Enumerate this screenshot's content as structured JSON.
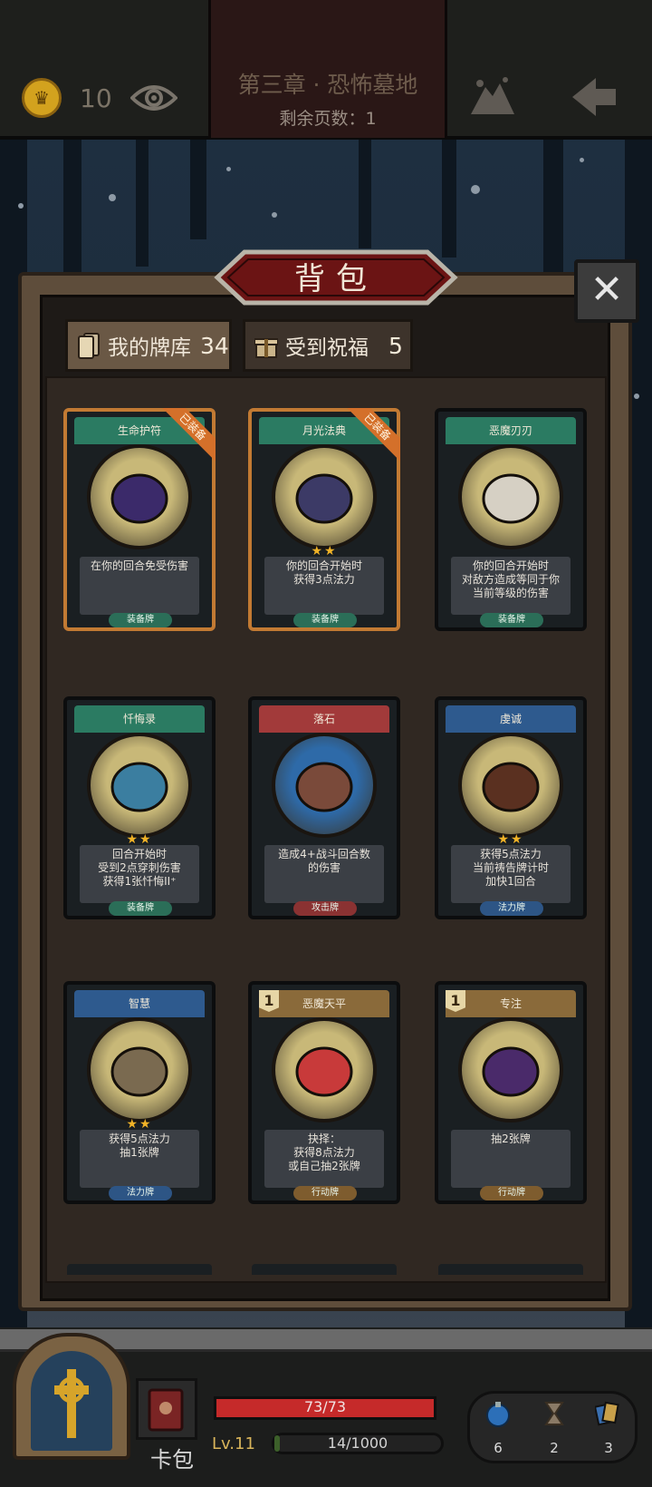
{
  "header": {
    "chapter_title": "第三章 · 恐怖墓地",
    "pages_left": "剩余页数：1",
    "coins": "10",
    "coin_icon": "crown-coin-icon",
    "eye_icon": "eye-icon",
    "map_icon": "map-icon",
    "back_icon": "back-arrow-icon"
  },
  "modal": {
    "title": "背包",
    "close_icon": "close-icon",
    "tabs": [
      {
        "label": "我的牌库",
        "count": "34",
        "icon": "cards-icon",
        "active": true
      },
      {
        "label": "受到祝福",
        "count": "5",
        "icon": "gift-icon",
        "active": false
      }
    ]
  },
  "cards": [
    {
      "name": "生命护符",
      "desc": "在你的回合免受伤害",
      "type": "装备牌",
      "stars": "",
      "equipped_label": "已装备",
      "color": "green",
      "art": "bat-amulet"
    },
    {
      "name": "月光法典",
      "desc": "你的回合开始时\n获得3点法力",
      "type": "装备牌",
      "stars": "★★",
      "equipped_label": "已装备",
      "color": "green",
      "art": "moon-tome"
    },
    {
      "name": "恶魔刃刃",
      "desc": "你的回合开始时\n对敌方造成等同于你\n当前等级的伤害",
      "type": "装备牌",
      "stars": "",
      "equipped_label": "",
      "color": "green",
      "art": "demon-blade"
    },
    {
      "name": "忏悔录",
      "desc": "回合开始时\n受到2点穿刺伤害\n获得1张忏悔II⁺",
      "type": "装备牌",
      "stars": "★★",
      "equipped_label": "",
      "color": "green",
      "art": "confession-book"
    },
    {
      "name": "落石",
      "desc": "造成4+战斗回合数\n的伤害",
      "type": "攻击牌",
      "stars": "",
      "equipped_label": "",
      "color": "red",
      "art": "falling-rocks"
    },
    {
      "name": "虔诚",
      "desc": "获得5点法力\n当前祷告牌计时\n加快1回合",
      "type": "法力牌",
      "stars": "★★",
      "equipped_label": "",
      "color": "blue",
      "art": "praying-monk"
    },
    {
      "name": "智慧",
      "desc": "获得5点法力\n抽1张牌",
      "type": "法力牌",
      "stars": "★★",
      "equipped_label": "",
      "color": "blue",
      "art": "old-sage"
    },
    {
      "name": "恶魔天平",
      "desc": "抉择：\n获得8点法力\n或自己抽2张牌",
      "type": "行动牌",
      "stars": "",
      "equipped_label": "",
      "color": "brown",
      "art": "demon-scale",
      "cost": "1"
    },
    {
      "name": "专注",
      "desc": "抽2张牌",
      "type": "行动牌",
      "stars": "",
      "equipped_label": "",
      "color": "brown",
      "art": "focused-wizard",
      "cost": "1"
    }
  ],
  "hud": {
    "deck_label": "卡包",
    "hp": "73/73",
    "hp_fraction": 1.0,
    "level": "Lv.11",
    "xp": "14/1000",
    "xp_fraction": 0.014,
    "items": [
      {
        "icon": "potion-icon",
        "count": "6"
      },
      {
        "icon": "hourglass-icon",
        "count": "2"
      },
      {
        "icon": "card-stack-icon",
        "count": "3"
      }
    ]
  }
}
